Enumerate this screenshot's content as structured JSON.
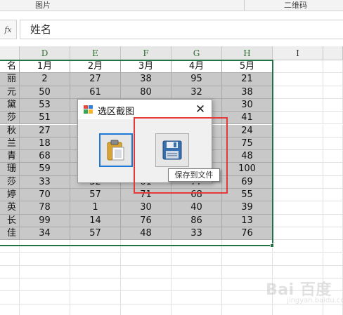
{
  "ribbon": {
    "group_left": "图片",
    "group_right": "二维码"
  },
  "formula_bar": {
    "fx_label": "fx",
    "value": "姓名"
  },
  "columns": [
    {
      "letter": "D"
    },
    {
      "letter": "E"
    },
    {
      "letter": "F"
    },
    {
      "letter": "G"
    },
    {
      "letter": "H"
    },
    {
      "letter": "I"
    }
  ],
  "table": {
    "header": [
      "名",
      "1月",
      "2月",
      "3月",
      "4月",
      "5月"
    ],
    "rows": [
      [
        "丽",
        "2",
        "27",
        "38",
        "95",
        "21"
      ],
      [
        "元",
        "50",
        "61",
        "80",
        "32",
        "38"
      ],
      [
        "黛",
        "53",
        "",
        "",
        "",
        "30"
      ],
      [
        "莎",
        "51",
        "",
        "",
        "",
        "41"
      ],
      [
        "秋",
        "27",
        "",
        "",
        "",
        "24"
      ],
      [
        "兰",
        "18",
        "",
        "",
        "",
        "75"
      ],
      [
        "青",
        "68",
        "",
        "",
        "",
        "48"
      ],
      [
        "珊",
        "59",
        "",
        "",
        "",
        "100"
      ],
      [
        "莎",
        "33",
        "52",
        "61",
        "77",
        "69"
      ],
      [
        "婷",
        "70",
        "57",
        "71",
        "68",
        "55"
      ],
      [
        "英",
        "78",
        "1",
        "30",
        "40",
        "39"
      ],
      [
        "长",
        "99",
        "14",
        "76",
        "86",
        "13"
      ],
      [
        "佳",
        "34",
        "57",
        "48",
        "33",
        "76"
      ]
    ]
  },
  "dialog": {
    "title": "选区截图",
    "close_glyph": "✕",
    "tooltip": "保存到文件"
  },
  "watermark": {
    "main": "Bai  百度",
    "sub": "jingyan.baidu.com"
  },
  "colors": {
    "selection": "#217346",
    "highlight": "#e23a3a",
    "focus": "#1e78d7"
  }
}
